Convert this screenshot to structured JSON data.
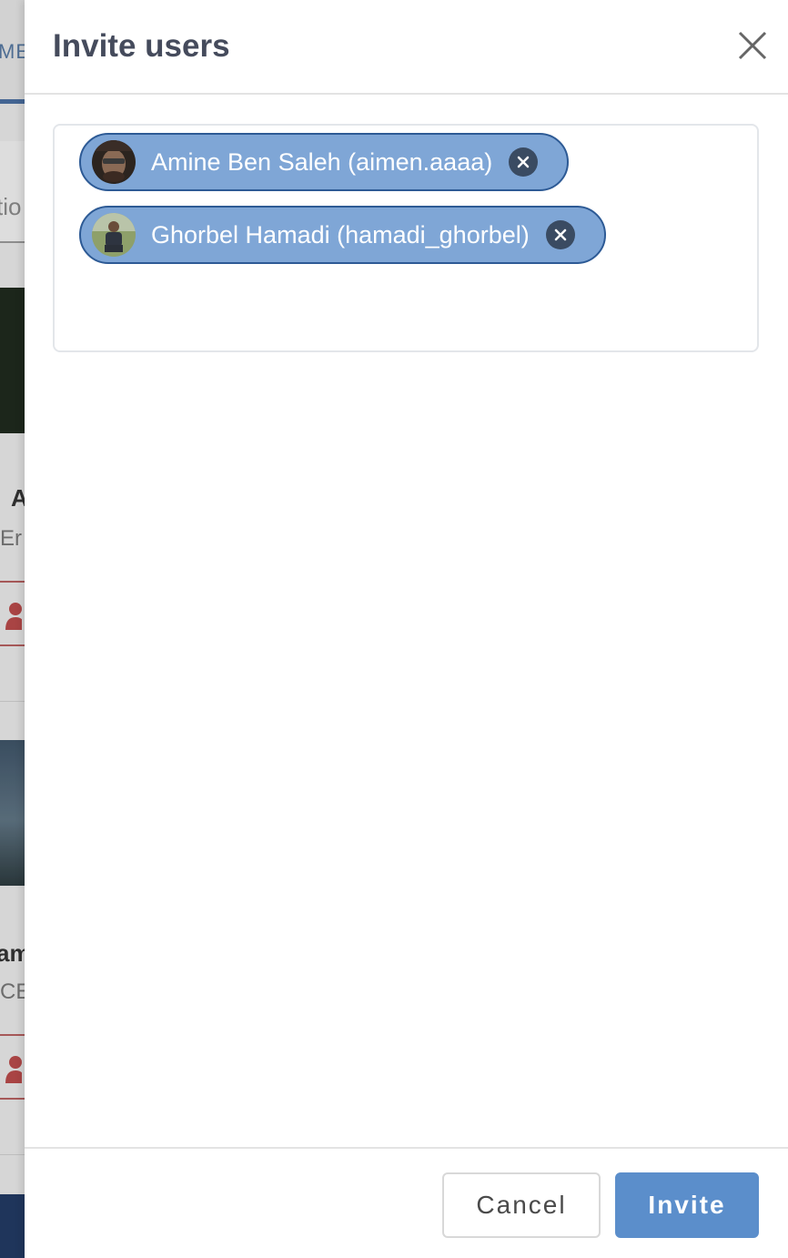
{
  "background": {
    "nav_text": "ME",
    "tab_text": "tio",
    "card1_name": "A",
    "card1_sub": "Er",
    "card2_name": "am",
    "card2_sub": "CE"
  },
  "modal": {
    "title": "Invite users",
    "close_icon": "close-icon",
    "selected_users": [
      {
        "label": "Amine Ben Saleh (aimen.aaaa)",
        "avatar": "avatar-photo",
        "remove_icon": "remove-icon"
      },
      {
        "label": "Ghorbel Hamadi (hamadi_ghorbel)",
        "avatar": "avatar-photo",
        "remove_icon": "remove-icon"
      }
    ],
    "footer": {
      "cancel_label": "Cancel",
      "invite_label": "Invite"
    }
  },
  "colors": {
    "chip_bg": "#7fa6d6",
    "chip_border": "#2d5a95",
    "primary": "#5b8ecb",
    "title": "#454b5c"
  }
}
